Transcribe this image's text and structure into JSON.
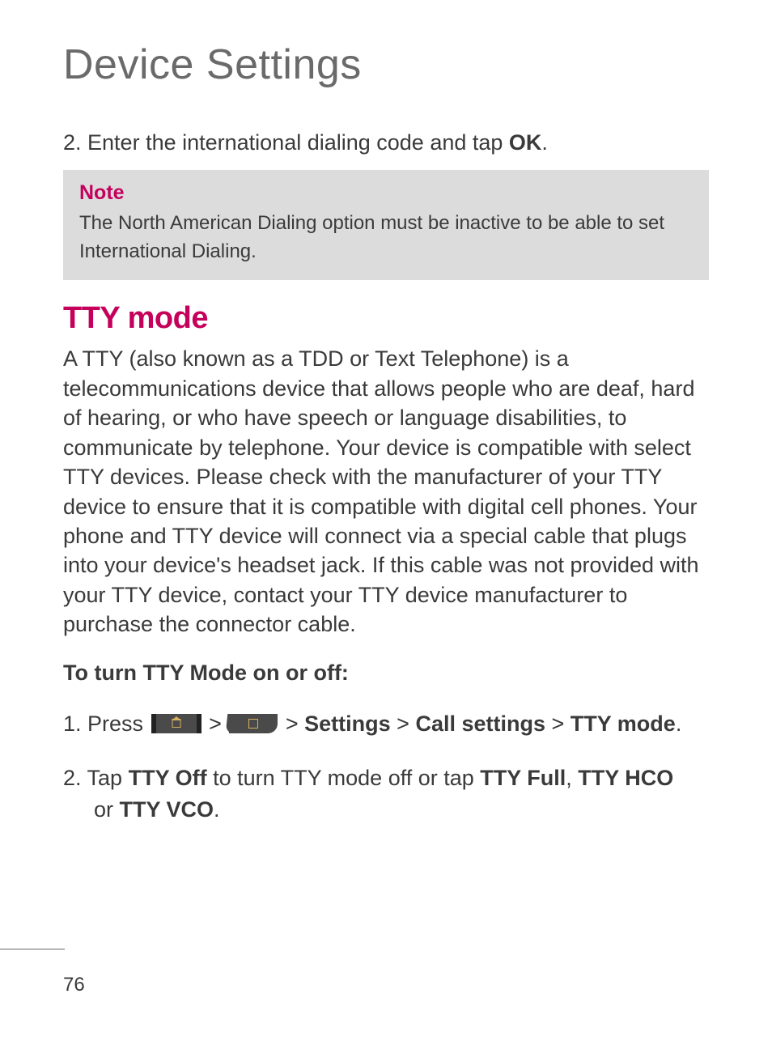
{
  "page_title": "Device Settings",
  "intro_step": {
    "number": "2.",
    "text_before": " Enter the international dialing code and tap ",
    "bold": "OK",
    "after": "."
  },
  "note": {
    "title": "Note",
    "body": "The North American Dialing option must be inactive to be able to set International Dialing."
  },
  "section_heading": "TTY mode",
  "tty_body": "A TTY (also known as a TDD or Text Telephone) is a telecommunications device that allows people who are deaf, hard of hearing, or who have speech or language disabilities, to communicate by telephone. Your device is compatible with select TTY devices. Please check with the manufacturer of your TTY device to ensure that it is compatible with digital cell phones. Your phone and TTY device will connect via a special cable that plugs into your device's headset jack. If this cable was not provided with your TTY device, contact your TTY device manufacturer to purchase the connector cable.",
  "sub_heading": "To turn TTY Mode on or off:",
  "step1": {
    "number": "1.",
    "press": " Press ",
    "sep1": " > ",
    "sep2": " > ",
    "path1": "Settings",
    "sep3": " > ",
    "path2": "Call settings",
    "sep4": " > ",
    "path3": "TTY mode",
    "end": "."
  },
  "step2": {
    "number": "2.",
    "t1": " Tap ",
    "b1": "TTY Off",
    "t2": " to turn TTY mode off or tap ",
    "b2": "TTY Full",
    "t3": ", ",
    "b3": "TTY HCO",
    "t4": "or ",
    "b4": "TTY VCO",
    "t5": "."
  },
  "page_number": "76"
}
